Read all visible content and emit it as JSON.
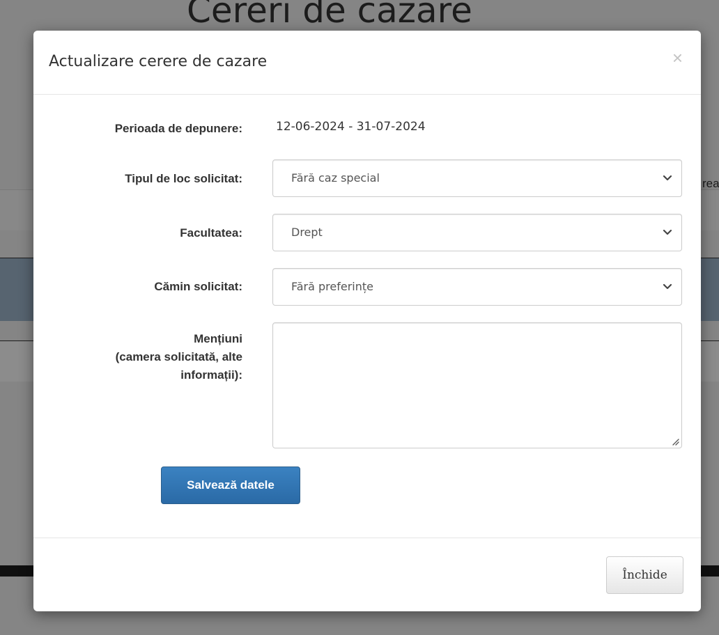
{
  "background": {
    "page_title": "Cereri de cazare",
    "side_text": "rea"
  },
  "modal": {
    "title": "Actualizare cerere de cazare",
    "close_symbol": "×",
    "period": {
      "label": "Perioada de depunere:",
      "value": "12-06-2024 - 31-07-2024"
    },
    "place_type": {
      "label": "Tipul de loc solicitat:",
      "value": "Fără caz special"
    },
    "faculty": {
      "label": "Facultatea:",
      "value": "Drept"
    },
    "dorm": {
      "label": "Cămin solicitat:",
      "value": "Fără preferințe"
    },
    "mentions": {
      "label_line1": "Mențiuni",
      "label_line2": "(camera solicitată, alte",
      "label_line3": "informații):",
      "value": ""
    },
    "save_label": "Salvează datele",
    "close_label": "Închide"
  },
  "colors": {
    "primary": "#2a6aa6",
    "backdrop": "#000000"
  },
  "icons": [
    "close-icon",
    "chevron-down-icon",
    "resize-handle-icon"
  ]
}
